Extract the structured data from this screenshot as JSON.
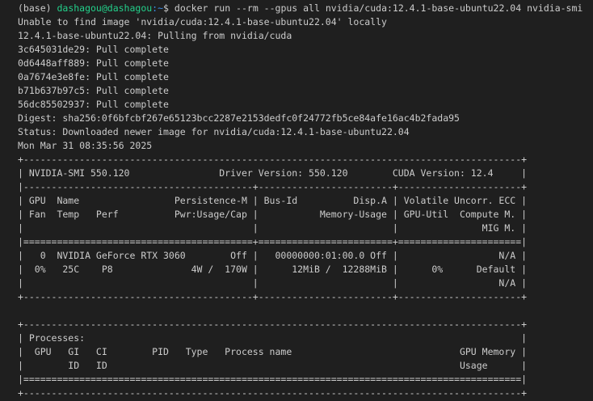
{
  "prompt": {
    "env": "(base) ",
    "user_host": "dashagou@dashagou",
    "path": ":~",
    "symbol": "$ ",
    "command": "docker run --rm --gpus all nvidia/cuda:12.4.1-base-ubuntu22.04 nvidia-smi"
  },
  "output_lines": [
    "Unable to find image 'nvidia/cuda:12.4.1-base-ubuntu22.04' locally",
    "12.4.1-base-ubuntu22.04: Pulling from nvidia/cuda",
    "3c645031de29: Pull complete",
    "0d6448aff889: Pull complete",
    "0a7674e3e8fe: Pull complete",
    "b71b637b97c5: Pull complete",
    "56dc85502937: Pull complete",
    "Digest: sha256:0f6bfcbf267e65123bcc2287e2153dedfc0f24772fb5ce84afe16ac4b2fada95",
    "Status: Downloaded newer image for nvidia/cuda:12.4.1-base-ubuntu22.04",
    "Mon Mar 31 08:35:56 2025",
    "+-----------------------------------------------------------------------------------------+",
    "| NVIDIA-SMI 550.120                Driver Version: 550.120        CUDA Version: 12.4     |",
    "|-----------------------------------------+------------------------+----------------------+",
    "| GPU  Name                 Persistence-M | Bus-Id          Disp.A | Volatile Uncorr. ECC |",
    "| Fan  Temp   Perf          Pwr:Usage/Cap |           Memory-Usage | GPU-Util  Compute M. |",
    "|                                         |                        |               MIG M. |",
    "|=========================================+========================+======================|",
    "|   0  NVIDIA GeForce RTX 3060        Off |   00000000:01:00.0 Off |                  N/A |",
    "|  0%   25C    P8              4W /  170W |      12MiB /  12288MiB |      0%      Default |",
    "|                                         |                        |                  N/A |",
    "+-----------------------------------------+------------------------+----------------------+",
    "",
    "+-----------------------------------------------------------------------------------------+",
    "| Processes:                                                                              |",
    "|  GPU   GI   CI        PID   Type   Process name                              GPU Memory |",
    "|        ID   ID                                                               Usage      |",
    "|=========================================================================================|",
    "+-----------------------------------------------------------------------------------------+"
  ]
}
